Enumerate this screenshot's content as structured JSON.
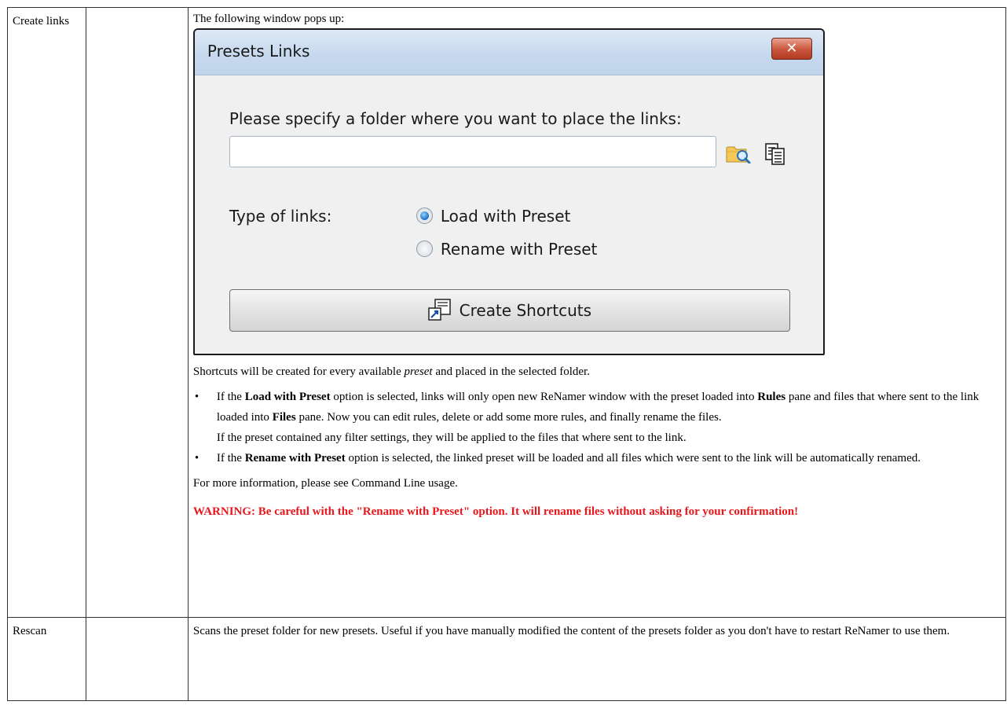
{
  "rows": [
    {
      "name": "Create links",
      "description": {
        "intro": "The following window pops up:",
        "dialog": {
          "title": "Presets Links",
          "close_glyph": "✕",
          "prompt": "Please specify a folder where you want to place the links:",
          "folder_value": "",
          "type_label": "Type of links:",
          "options": [
            {
              "label": "Load with Preset",
              "selected": true
            },
            {
              "label": "Rename with Preset",
              "selected": false
            }
          ],
          "button_label": "Create Shortcuts"
        },
        "shortcuts_text_before": "Shortcuts will be created for every available ",
        "shortcuts_text_em": "preset",
        "shortcuts_text_after": " and placed in the selected folder.",
        "bullet1": {
          "t1": "If the ",
          "b1": "Load with Preset",
          "t2": " option is selected, links will only open new ReNamer window with the preset loaded into ",
          "b2": "Rules",
          "t3": " pane and files that where sent to the link loaded into ",
          "b3": "Files",
          "t4": " pane. Now you can edit rules, delete or add some more rules, and finally rename the files.",
          "extra": "If the preset contained any filter settings, they will be applied to the files that where sent to the link."
        },
        "bullet2": {
          "t1": "If the ",
          "b1": "Rename with Preset",
          "t2": " option is selected, the linked preset will be loaded and all files which were sent to the link will be automatically renamed."
        },
        "more_info": "For more information, please see Command Line usage.",
        "warning": "WARNING: Be careful with the \"Rename with Preset\" option. It will rename files without asking for your confirmation!"
      }
    },
    {
      "name": "Rescan",
      "description": "Scans the preset folder for new presets. Useful if you have manually modified the content of the presets folder as you don't have to restart ReNamer to use them."
    }
  ],
  "colors": {
    "warning": "#e8161a",
    "titlebar": "#c5d8ee",
    "close_button": "#c8553a",
    "radio_selected": "#1e6fc9"
  },
  "icons": [
    "close-icon",
    "browse-folder-icon",
    "paste-icon",
    "shortcut-icon"
  ]
}
